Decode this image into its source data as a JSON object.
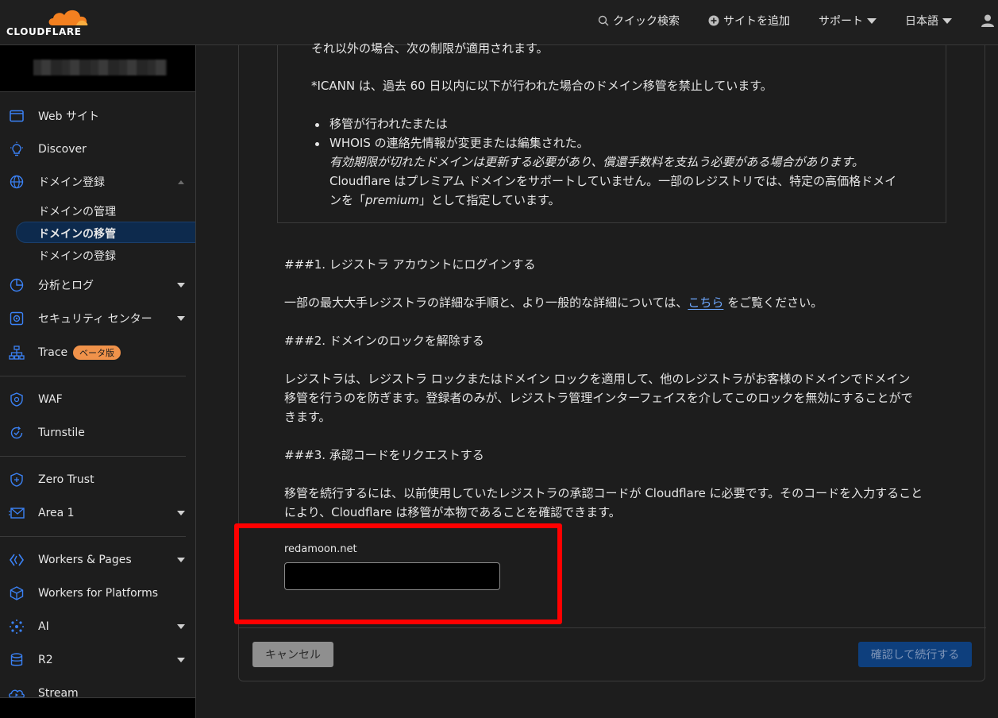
{
  "brand": {
    "name": "CLOUDFLARE"
  },
  "topnav": {
    "quick_search": "クイック検索",
    "add_site": "サイトを追加",
    "support": "サポート",
    "language": "日本語"
  },
  "sidebar": {
    "items": [
      {
        "label": "Web サイト",
        "icon": "browser-window-icon"
      },
      {
        "label": "Discover",
        "icon": "lightbulb-icon"
      },
      {
        "label": "ドメイン登録",
        "icon": "globe-icon"
      },
      {
        "label": "分析とログ",
        "icon": "pie-chart-icon"
      },
      {
        "label": "セキュリティ センター",
        "icon": "security-center-icon"
      },
      {
        "label": "Trace",
        "icon": "trace-icon",
        "badge": "ベータ版"
      },
      {
        "label": "WAF",
        "icon": "waf-shield-icon"
      },
      {
        "label": "Turnstile",
        "icon": "turnstile-icon"
      },
      {
        "label": "Zero Trust",
        "icon": "zero-trust-icon"
      },
      {
        "label": "Area 1",
        "icon": "email-icon"
      },
      {
        "label": "Workers & Pages",
        "icon": "workers-icon"
      },
      {
        "label": "Workers for Platforms",
        "icon": "cube-icon"
      },
      {
        "label": "AI",
        "icon": "sparkle-icon"
      },
      {
        "label": "R2",
        "icon": "database-icon"
      },
      {
        "label": "Stream",
        "icon": "stream-icon"
      }
    ],
    "domain_sub": {
      "manage": "ドメインの管理",
      "transfer": "ドメインの移管",
      "register": "ドメインの登録"
    }
  },
  "notice": {
    "line_cut": "それ以外の場合、次の制限が適用されます。",
    "icann": "*ICANN は、過去 60 日以内に以下が行われた場合のドメイン移管を禁止しています。",
    "bullet1": "移管が行われたまたは",
    "bullet2": "WHOIS の連絡先情報が変更または編集された。",
    "italic": "有効期限が切れたドメインは更新する必要があり、償還手数料を支払う必要がある場合があります。",
    "premium_a": "Cloudflare はプレミアム ドメインをサポートしていません。一部のレジストリでは、特定の高価格ドメイ",
    "premium_b1": "ンを「",
    "premium_b2": "premium",
    "premium_b3": "」として指定しています。"
  },
  "steps": {
    "s1_title": "###1.  レジストラ アカウントにログインする",
    "s1_text_a": "一部の最大大手レジストラの詳細な手順と、より一般的な詳細については、",
    "s1_link": "こちら",
    "s1_text_b": " をご覧ください。",
    "s2_title": "###2.  ドメインのロックを解除する",
    "s2_l1": "レジストラは、レジストラ ロックまたはドメイン ロックを適用して、他のレジストラがお客様のドメインでドメイン",
    "s2_l2": "移管を行うのを防ぎます。登録者のみが、レジストラ管理インターフェイスを介してこのロックを無効にすることがで",
    "s2_l3": "きます。",
    "s3_title": "###3.  承認コードをリクエストする",
    "s3_l1": "移管を続行するには、以前使用していたレジストラの承認コードが Cloudflare に必要です。そのコードを入力すること",
    "s3_l2": "により、Cloudflare は移管が本物であることを確認できます。"
  },
  "form": {
    "domain_label": "redamoon.net",
    "auth_code_value": ""
  },
  "buttons": {
    "cancel": "キャンセル",
    "confirm": "確認して続行する"
  },
  "colors": {
    "accent_orange": "#f38020",
    "link_blue": "#6ea8ff",
    "highlight_red": "#ff0000",
    "active_nav_bg": "#0d2a4d",
    "icon_blue": "#3b82f6"
  }
}
